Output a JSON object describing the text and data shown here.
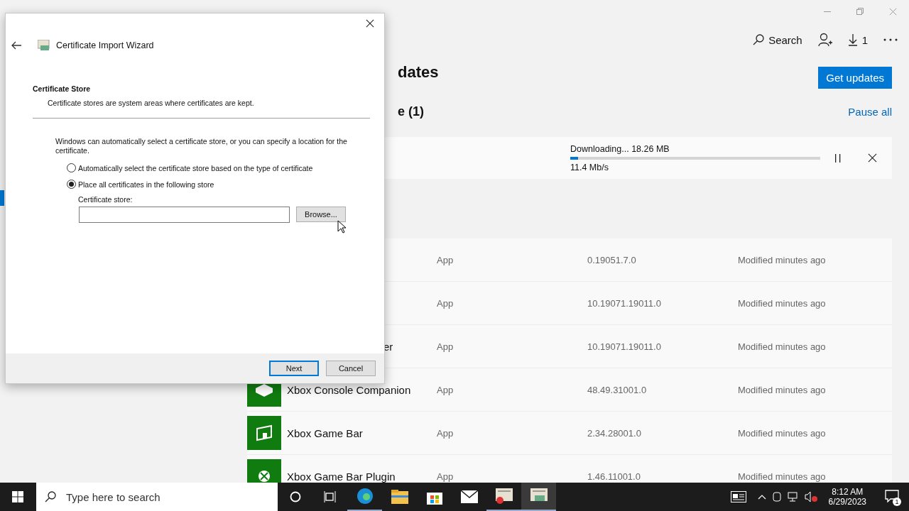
{
  "store": {
    "header": "dates",
    "section": "e (1)",
    "toolbar": {
      "search": "Search",
      "downloads": "1"
    },
    "get_updates": "Get updates",
    "pause_all": "Pause all",
    "download": {
      "status": "Downloading... 18.26 MB",
      "speed": "11.4 Mb/s",
      "level": 0.03
    },
    "rows": [
      {
        "kind": "hidden",
        "name": "",
        "type": "App",
        "version": "0.19051.7.0",
        "modified": "Modified minutes ago"
      },
      {
        "kind": "hidden",
        "name": "",
        "type": "App",
        "version": "10.19071.19011.0",
        "modified": "Modified minutes ago"
      },
      {
        "kind": "hidden",
        "name": "er",
        "type": "App",
        "version": "10.19071.19011.0",
        "modified": "Modified minutes ago"
      },
      {
        "kind": "console",
        "name": "Xbox Console Companion",
        "type": "App",
        "version": "48.49.31001.0",
        "modified": "Modified minutes ago"
      },
      {
        "kind": "panel",
        "name": "Xbox Game Bar",
        "type": "App",
        "version": "2.34.28001.0",
        "modified": "Modified minutes ago"
      },
      {
        "kind": "logo",
        "name": "Xbox Game Bar Plugin",
        "type": "App",
        "version": "1.46.11001.0",
        "modified": "Modified minutes ago"
      }
    ]
  },
  "dialog": {
    "title": "Certificate Import Wizard",
    "heading": "Certificate Store",
    "subtitle": "Certificate stores are system areas where certificates are kept.",
    "intro": "Windows can automatically select a certificate store, or you can specify a location for the certificate.",
    "options": [
      {
        "label": "Automatically select the certificate store based on the type of certificate",
        "selected": false
      },
      {
        "label": "Place all certificates in the following store",
        "selected": true
      }
    ],
    "store_label": "Certificate store:",
    "browse": "Browse...",
    "buttons": [
      {
        "label": "Next",
        "focused": true
      },
      {
        "label": "Cancel",
        "focused": false
      }
    ]
  },
  "taskbar": {
    "search_placeholder": "Type here to search",
    "time": "8:12 AM",
    "date": "6/29/2023",
    "notifications": "1"
  }
}
